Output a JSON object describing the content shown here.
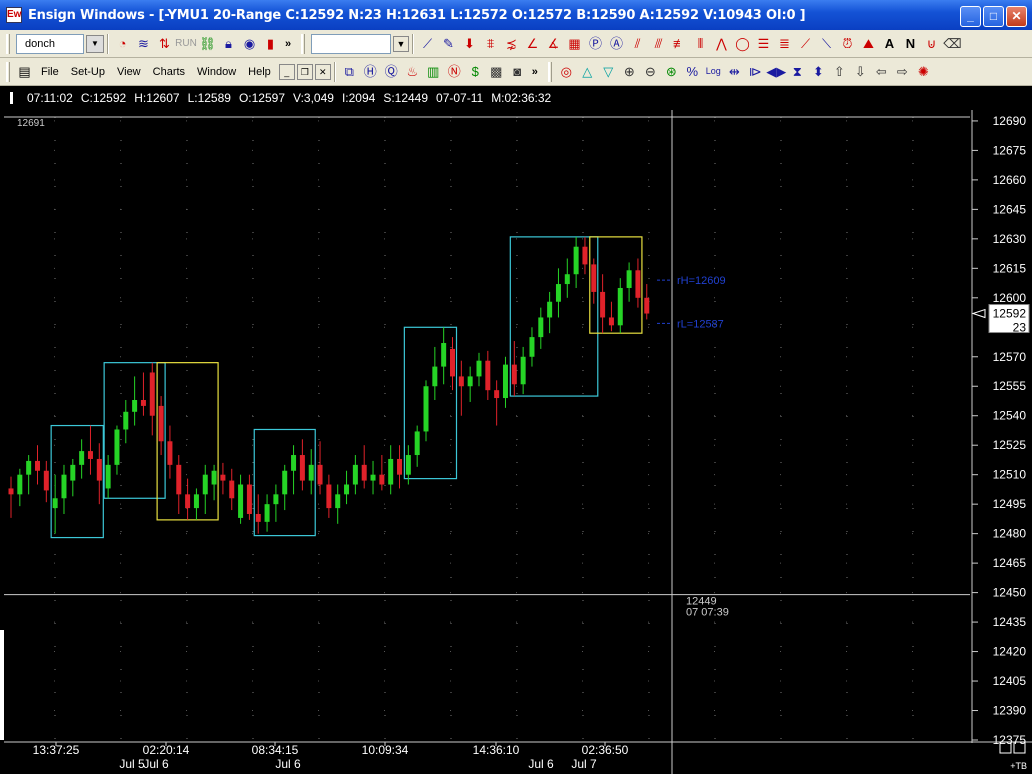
{
  "window": {
    "title": "Ensign Windows - [-YMU1 20-Range C:12592 N:23 H:12631 L:12572 O:12572 B:12590 A:12592 V:10943 OI:0 ]",
    "app_icon": "Ew",
    "minimize": "_",
    "maximize": "□",
    "close": "✕"
  },
  "toolbar1": {
    "study_name": "donch",
    "run_label": "RUN",
    "overflow": "»"
  },
  "menu": {
    "items": [
      "File",
      "Set-Up",
      "View",
      "Charts",
      "Window",
      "Help"
    ],
    "mdi_min": "_",
    "mdi_restore": "❐",
    "mdi_close": "✕",
    "overflow": "»"
  },
  "infobar": {
    "time": "07:11:02",
    "close": "C:12592",
    "high": "H:12607",
    "low": "L:12589",
    "open": "O:12597",
    "volume": "V:3,049",
    "interval": "I:2094",
    "start": "S:12449",
    "date": "07-07-11",
    "m": "M:02:36:32"
  },
  "chart_data": {
    "type": "candlestick",
    "symbol": "-YMU1",
    "top_label": "12691",
    "price_axis": [
      "12690",
      "12675",
      "12660",
      "12645",
      "12630",
      "12615",
      "12600",
      "12570",
      "12555",
      "12540",
      "12525",
      "12510",
      "12495",
      "12480",
      "12465",
      "12450",
      "12435",
      "12420",
      "12405",
      "12390",
      "12375"
    ],
    "ylim": [
      12375,
      12692
    ],
    "current_price": "12592",
    "current_count": "23",
    "time_labels": [
      "13:37:25",
      "02:20:14",
      "08:34:15",
      "10:09:34",
      "14:36:10",
      "02:36:50"
    ],
    "date_labels": [
      "Jul 5",
      "Jul 6",
      "Jul 6",
      "Jul 6",
      "Jul 7"
    ],
    "crosshair": {
      "price": "12449",
      "time_label": "07  07:39"
    },
    "range_lines": [
      {
        "label": "rH=12609",
        "value": 12609
      },
      {
        "label": "rL=12587",
        "value": 12587
      }
    ],
    "boxes": [
      {
        "color": "#3cc8d8",
        "from_bar": 5,
        "to_bar": 10,
        "high": 12535,
        "low": 12478
      },
      {
        "color": "#3cc8d8",
        "from_bar": 11,
        "to_bar": 17,
        "high": 12567,
        "low": 12498
      },
      {
        "color": "#e8e040",
        "from_bar": 17,
        "to_bar": 23,
        "high": 12567,
        "low": 12487
      },
      {
        "color": "#3cc8d8",
        "from_bar": 28,
        "to_bar": 34,
        "high": 12533,
        "low": 12479
      },
      {
        "color": "#3cc8d8",
        "from_bar": 45,
        "to_bar": 50,
        "high": 12585,
        "low": 12508
      },
      {
        "color": "#3cc8d8",
        "from_bar": 57,
        "to_bar": 66,
        "high": 12631,
        "low": 12550
      },
      {
        "color": "#e8e040",
        "from_bar": 66,
        "to_bar": 71,
        "high": 12631,
        "low": 12582
      }
    ],
    "candles": [
      [
        12503,
        12509,
        12488,
        12500
      ],
      [
        12500,
        12513,
        12494,
        12510
      ],
      [
        12510,
        12520,
        12500,
        12517
      ],
      [
        12517,
        12525,
        12505,
        12512
      ],
      [
        12512,
        12517,
        12496,
        12502
      ],
      [
        12493,
        12510,
        12480,
        12498
      ],
      [
        12498,
        12515,
        12490,
        12510
      ],
      [
        12507,
        12518,
        12499,
        12515
      ],
      [
        12515,
        12528,
        12508,
        12522
      ],
      [
        12522,
        12535,
        12510,
        12518
      ],
      [
        12518,
        12526,
        12495,
        12507
      ],
      [
        12503,
        12520,
        12498,
        12515
      ],
      [
        12515,
        12535,
        12510,
        12533
      ],
      [
        12533,
        12548,
        12526,
        12542
      ],
      [
        12542,
        12560,
        12535,
        12548
      ],
      [
        12548,
        12562,
        12540,
        12545
      ],
      [
        12562,
        12567,
        12530,
        12540
      ],
      [
        12545,
        12550,
        12520,
        12527
      ],
      [
        12527,
        12535,
        12508,
        12515
      ],
      [
        12515,
        12520,
        12490,
        12500
      ],
      [
        12500,
        12508,
        12487,
        12493
      ],
      [
        12493,
        12503,
        12487,
        12500
      ],
      [
        12500,
        12515,
        12490,
        12510
      ],
      [
        12505,
        12515,
        12497,
        12512
      ],
      [
        12510,
        12516,
        12500,
        12507
      ],
      [
        12507,
        12513,
        12492,
        12498
      ],
      [
        12488,
        12510,
        12485,
        12505
      ],
      [
        12505,
        12510,
        12487,
        12490
      ],
      [
        12490,
        12500,
        12480,
        12486
      ],
      [
        12486,
        12500,
        12481,
        12495
      ],
      [
        12495,
        12505,
        12486,
        12500
      ],
      [
        12500,
        12515,
        12492,
        12512
      ],
      [
        12512,
        12525,
        12500,
        12520
      ],
      [
        12520,
        12528,
        12502,
        12507
      ],
      [
        12507,
        12523,
        12500,
        12515
      ],
      [
        12515,
        12527,
        12500,
        12505
      ],
      [
        12505,
        12510,
        12488,
        12493
      ],
      [
        12493,
        12505,
        12485,
        12500
      ],
      [
        12500,
        12512,
        12495,
        12505
      ],
      [
        12505,
        12520,
        12500,
        12515
      ],
      [
        12515,
        12525,
        12503,
        12507
      ],
      [
        12507,
        12517,
        12500,
        12510
      ],
      [
        12510,
        12520,
        12502,
        12505
      ],
      [
        12505,
        12525,
        12500,
        12518
      ],
      [
        12518,
        12525,
        12503,
        12510
      ],
      [
        12510,
        12525,
        12505,
        12520
      ],
      [
        12520,
        12535,
        12514,
        12532
      ],
      [
        12532,
        12558,
        12527,
        12555
      ],
      [
        12555,
        12575,
        12548,
        12565
      ],
      [
        12565,
        12585,
        12556,
        12577
      ],
      [
        12574,
        12580,
        12553,
        12560
      ],
      [
        12560,
        12568,
        12540,
        12555
      ],
      [
        12555,
        12565,
        12547,
        12560
      ],
      [
        12560,
        12572,
        12555,
        12568
      ],
      [
        12568,
        12573,
        12548,
        12553
      ],
      [
        12553,
        12558,
        12535,
        12549
      ],
      [
        12549,
        12570,
        12544,
        12566
      ],
      [
        12566,
        12578,
        12550,
        12556
      ],
      [
        12556,
        12575,
        12551,
        12570
      ],
      [
        12570,
        12585,
        12565,
        12580
      ],
      [
        12580,
        12595,
        12574,
        12590
      ],
      [
        12590,
        12603,
        12582,
        12598
      ],
      [
        12598,
        12615,
        12590,
        12607
      ],
      [
        12607,
        12620,
        12600,
        12612
      ],
      [
        12612,
        12631,
        12605,
        12626
      ],
      [
        12626,
        12631,
        12612,
        12617
      ],
      [
        12617,
        12620,
        12597,
        12603
      ],
      [
        12603,
        12612,
        12582,
        12590
      ],
      [
        12590,
        12598,
        12583,
        12586
      ],
      [
        12586,
        12610,
        12582,
        12605
      ],
      [
        12605,
        12618,
        12598,
        12614
      ],
      [
        12614,
        12620,
        12595,
        12600
      ],
      [
        12600,
        12607,
        12589,
        12592
      ]
    ]
  },
  "corner": {
    "tb_label": "+TB"
  }
}
